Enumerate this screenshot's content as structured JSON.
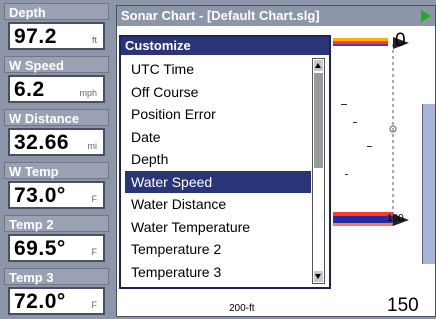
{
  "gauges": [
    {
      "label": "Depth",
      "value": "97.2",
      "unit": "ft"
    },
    {
      "label": "W Speed",
      "value": "6.2",
      "unit": "mph"
    },
    {
      "label": "W Distance",
      "value": "32.66",
      "unit": "mi"
    },
    {
      "label": "W Temp",
      "value": "73.0°",
      "unit": "F"
    },
    {
      "label": "Temp 2",
      "value": "69.5°",
      "unit": "F"
    },
    {
      "label": "Temp 3",
      "value": "72.0°",
      "unit": "F"
    }
  ],
  "window": {
    "title": "Sonar Chart - [Default Chart.slg]",
    "depth_top": "0",
    "depth_mid": "100",
    "depth_bottom": "150",
    "frequency_label": "200-ft"
  },
  "menu": {
    "title": "Customize",
    "items": [
      "UTC Time",
      "Off Course",
      "Position Error",
      "Date",
      "Depth",
      "Water Speed",
      "Water Distance",
      "Water Temperature",
      "Temperature 2",
      "Temperature 3"
    ],
    "selected": "Water Speed"
  },
  "colors": {
    "accent": "#2a3478",
    "bottom_echo": "#ff3b2a",
    "surface_echo": "#ffb100"
  }
}
